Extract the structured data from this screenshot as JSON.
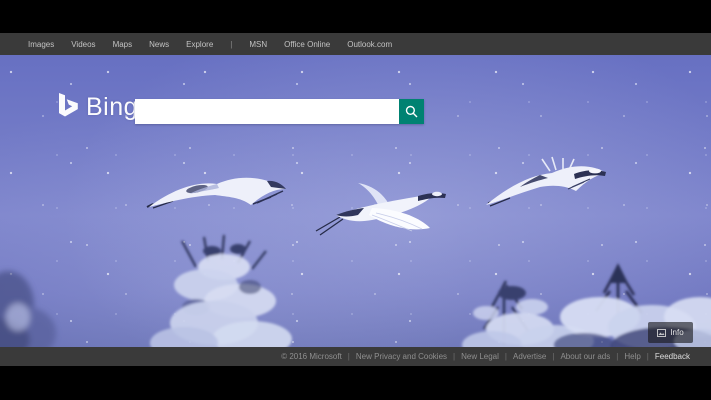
{
  "nav": {
    "left_items": [
      "Images",
      "Videos",
      "Maps",
      "News",
      "Explore"
    ],
    "divider": "|",
    "right_items": [
      "MSN",
      "Office Online",
      "Outlook.com"
    ]
  },
  "logo": {
    "text": "Bing"
  },
  "search": {
    "value": ""
  },
  "hero": {
    "info_button_label": "Info",
    "scene_description": "three red-crowned cranes flying through falling snow above snow-covered evergreen trees"
  },
  "footer": {
    "copyright": "© 2016 Microsoft",
    "divider": "|",
    "links": [
      "New Privacy and Cookies",
      "New Legal",
      "Advertise",
      "About our ads",
      "Help"
    ],
    "feedback": "Feedback"
  },
  "colors": {
    "letterbox": "#000000",
    "bar_background": "#3a3a3a",
    "accent_teal": "#008272",
    "photo_blue": "#747cc6"
  }
}
